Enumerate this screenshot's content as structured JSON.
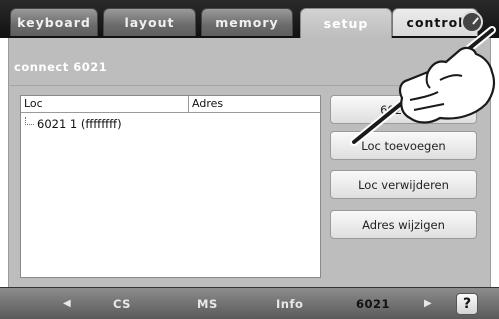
{
  "tabs": {
    "keyboard": "keyboard",
    "layout": "layout",
    "memory": "memory",
    "setup": "setup",
    "control": "control"
  },
  "page": {
    "title": "connect 6021"
  },
  "list": {
    "columns": [
      "Loc",
      "Adres"
    ],
    "rows": [
      {
        "loc": "6021 1 (ffffffff)",
        "adres": ""
      }
    ]
  },
  "buttons": {
    "b6021": "6021 ve",
    "loc_add": "Loc toevoegen",
    "loc_remove": "Loc verwijderen",
    "adres_change": "Adres wijzigen"
  },
  "bottom_nav": {
    "prev": "◀",
    "cs": "CS",
    "ms": "MS",
    "info": "Info",
    "current": "6021",
    "next": "▶",
    "help": "?"
  },
  "icons": {
    "clock": "clock-icon",
    "hand": "pointing-hand-with-stylus-icon"
  }
}
